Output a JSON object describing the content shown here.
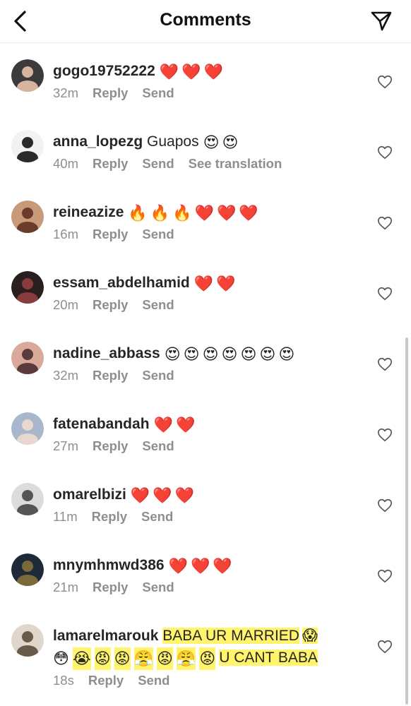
{
  "header": {
    "title": "Comments"
  },
  "comments": [
    {
      "user": "gogo19752222",
      "text": "",
      "emojis": [
        "❤️",
        "❤️",
        "❤️"
      ],
      "time": "32m",
      "actions": [
        "Reply",
        "Send"
      ]
    },
    {
      "user": "anna_lopezg",
      "text": "Guapos",
      "emojis": [
        "😍",
        "😍"
      ],
      "time": "40m",
      "actions": [
        "Reply",
        "Send",
        "See translation"
      ]
    },
    {
      "user": "reineazize",
      "text": "",
      "emojis": [
        "🔥",
        "🔥",
        "🔥",
        "❤️",
        "❤️",
        "❤️"
      ],
      "time": "16m",
      "actions": [
        "Reply",
        "Send"
      ]
    },
    {
      "user": "essam_abdelhamid",
      "text": "",
      "emojis": [
        "❤️",
        "❤️"
      ],
      "time": "20m",
      "actions": [
        "Reply",
        "Send"
      ]
    },
    {
      "user": "nadine_abbass",
      "text": "",
      "emojis": [
        "😍",
        "😍",
        "😍",
        "😍",
        "😍",
        "😍",
        "😍"
      ],
      "time": "32m",
      "actions": [
        "Reply",
        "Send"
      ]
    },
    {
      "user": "fatenabandah",
      "text": "",
      "emojis": [
        "❤️",
        "❤️"
      ],
      "time": "27m",
      "actions": [
        "Reply",
        "Send"
      ]
    },
    {
      "user": "omarelbizi",
      "text": "",
      "emojis": [
        "❤️",
        "❤️",
        "❤️"
      ],
      "time": "11m",
      "actions": [
        "Reply",
        "Send"
      ]
    },
    {
      "user": "mnymhmwd386",
      "text": "",
      "emojis": [
        "❤️",
        "❤️",
        "❤️"
      ],
      "time": "21m",
      "actions": [
        "Reply",
        "Send"
      ]
    }
  ],
  "last_comment": {
    "user": "lamarelmarouk",
    "text_line1": "BABA UR MARRIED",
    "line1_emoji": "😱",
    "line2_emojis": [
      "😳",
      "😭",
      "😡",
      "😡",
      "😤",
      "😡",
      "😤",
      "😡"
    ],
    "text_line2": "U CANT BABA",
    "time": "18s",
    "actions": [
      "Reply",
      "Send"
    ]
  },
  "colors": {
    "highlight": "#fff46a",
    "heart": "#ed1c24",
    "meta": "#8e8e8e"
  },
  "icons": {
    "back": "chevron-left-icon",
    "send": "paper-plane-icon",
    "like": "heart-outline-icon"
  }
}
